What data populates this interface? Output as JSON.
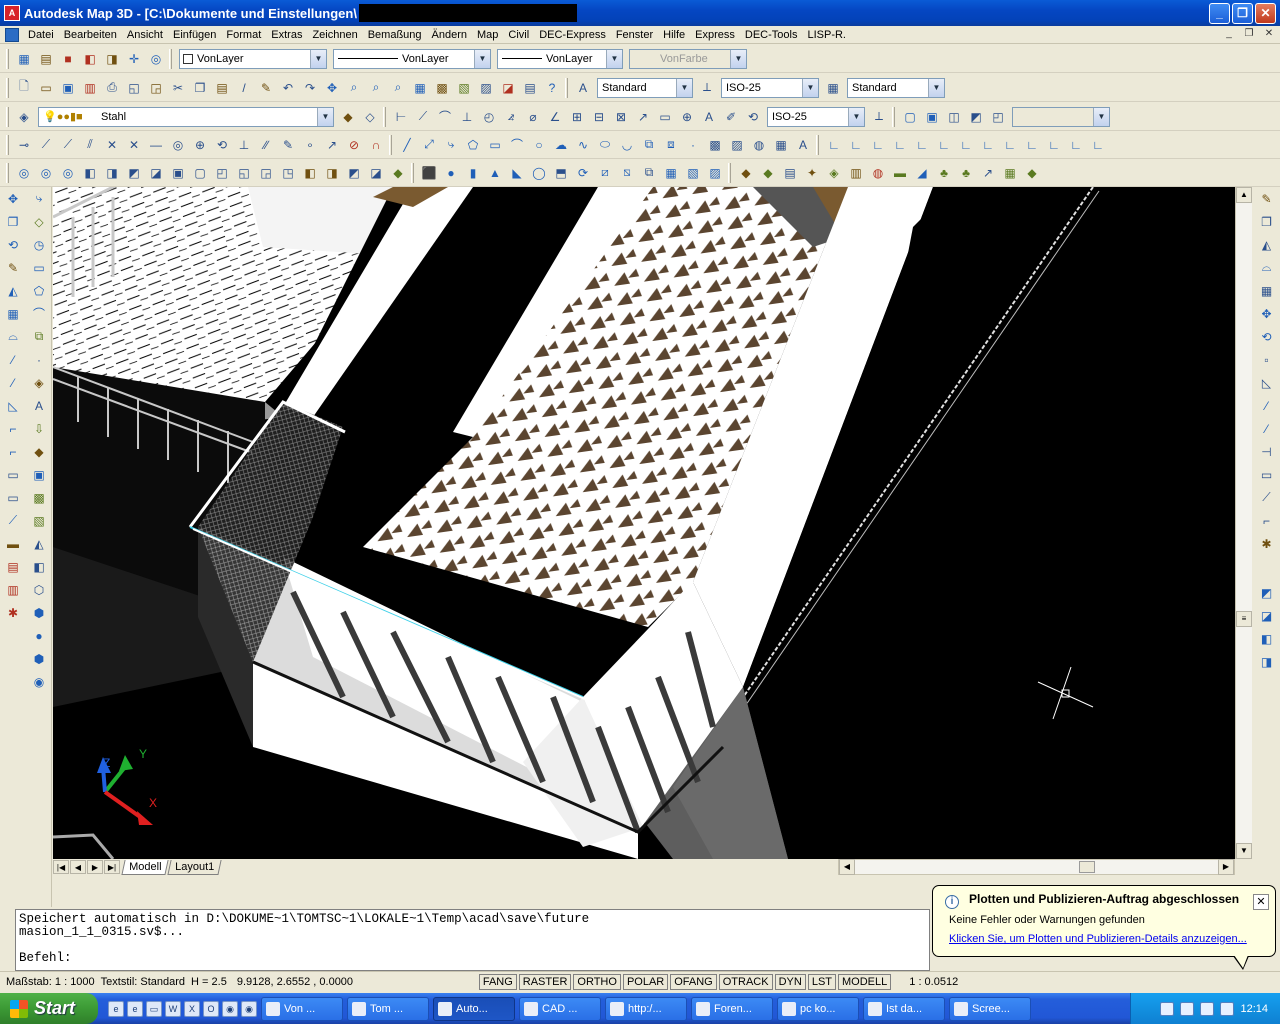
{
  "window": {
    "title": "Autodesk Map 3D - [C:\\Dokumente und Einstellungen\\",
    "app_icon": "autocad-icon",
    "minimize_label": "_",
    "restore_label": "❐",
    "close_label": "✕"
  },
  "menu": {
    "items": [
      "Datei",
      "Bearbeiten",
      "Ansicht",
      "Einfügen",
      "Format",
      "Extras",
      "Zeichnen",
      "Bemaßung",
      "Ändern",
      "Map",
      "Civil",
      "DEC-Express",
      "Fenster",
      "Hilfe",
      "Express",
      "DEC-Tools",
      "LISP-R."
    ]
  },
  "props_toolbar": {
    "layer_combo": "VonLayer",
    "linetype_combo": "VonLayer",
    "lineweight_combo": "VonLayer",
    "color_combo": "VonFarbe"
  },
  "styles_toolbar": {
    "textstyle": "Standard",
    "dimstyle": "ISO-25",
    "tablestyle": "Standard"
  },
  "layer_toolbar": {
    "current_layer": "Stahl",
    "dimstyle2": "ISO-25"
  },
  "layout_tabs": [
    "Modell",
    "Layout1"
  ],
  "ucs": {
    "x_label": "X",
    "y_label": "Y",
    "z_label": "Z"
  },
  "command": {
    "history_line1": "Speichert automatisch in D:\\DOKUME~1\\TOMTSC~1\\LOKALE~1\\Temp\\acad\\save\\future",
    "history_line2": "masion_1_1_0315.sv$...",
    "prompt": "Befehl:"
  },
  "balloon": {
    "title": "Plotten und Publizieren-Auftrag abgeschlossen",
    "message": "Keine Fehler oder Warnungen gefunden",
    "link": "Klicken Sie, um Plotten und Publizieren-Details anzuzeigen...",
    "close_label": "✕",
    "info_label": "i"
  },
  "status": {
    "scale": "Maßstab: 1 : 1000",
    "textstyle": "Textstil: Standard",
    "height": "H = 2.5",
    "coords": "9.9128, 2.6552 , 0.0000",
    "toggles": [
      "FANG",
      "RASTER",
      "ORTHO",
      "POLAR",
      "OFANG",
      "OTRACK",
      "DYN",
      "LST",
      "MODELL"
    ],
    "viewscale": "1 : 0.0512"
  },
  "taskbar": {
    "start_label": "Start",
    "buttons": [
      "Von ...",
      "Tom ...",
      "Auto...",
      "CAD ...",
      "http:/...",
      "Foren...",
      "pc ko...",
      "Ist da...",
      "Scree..."
    ],
    "clock": "12:14"
  },
  "colors": {
    "accent": "#0a5bd6",
    "viewport_bg": "#000000",
    "hatch": "#5b4530",
    "selection": "#3fd0e8"
  }
}
